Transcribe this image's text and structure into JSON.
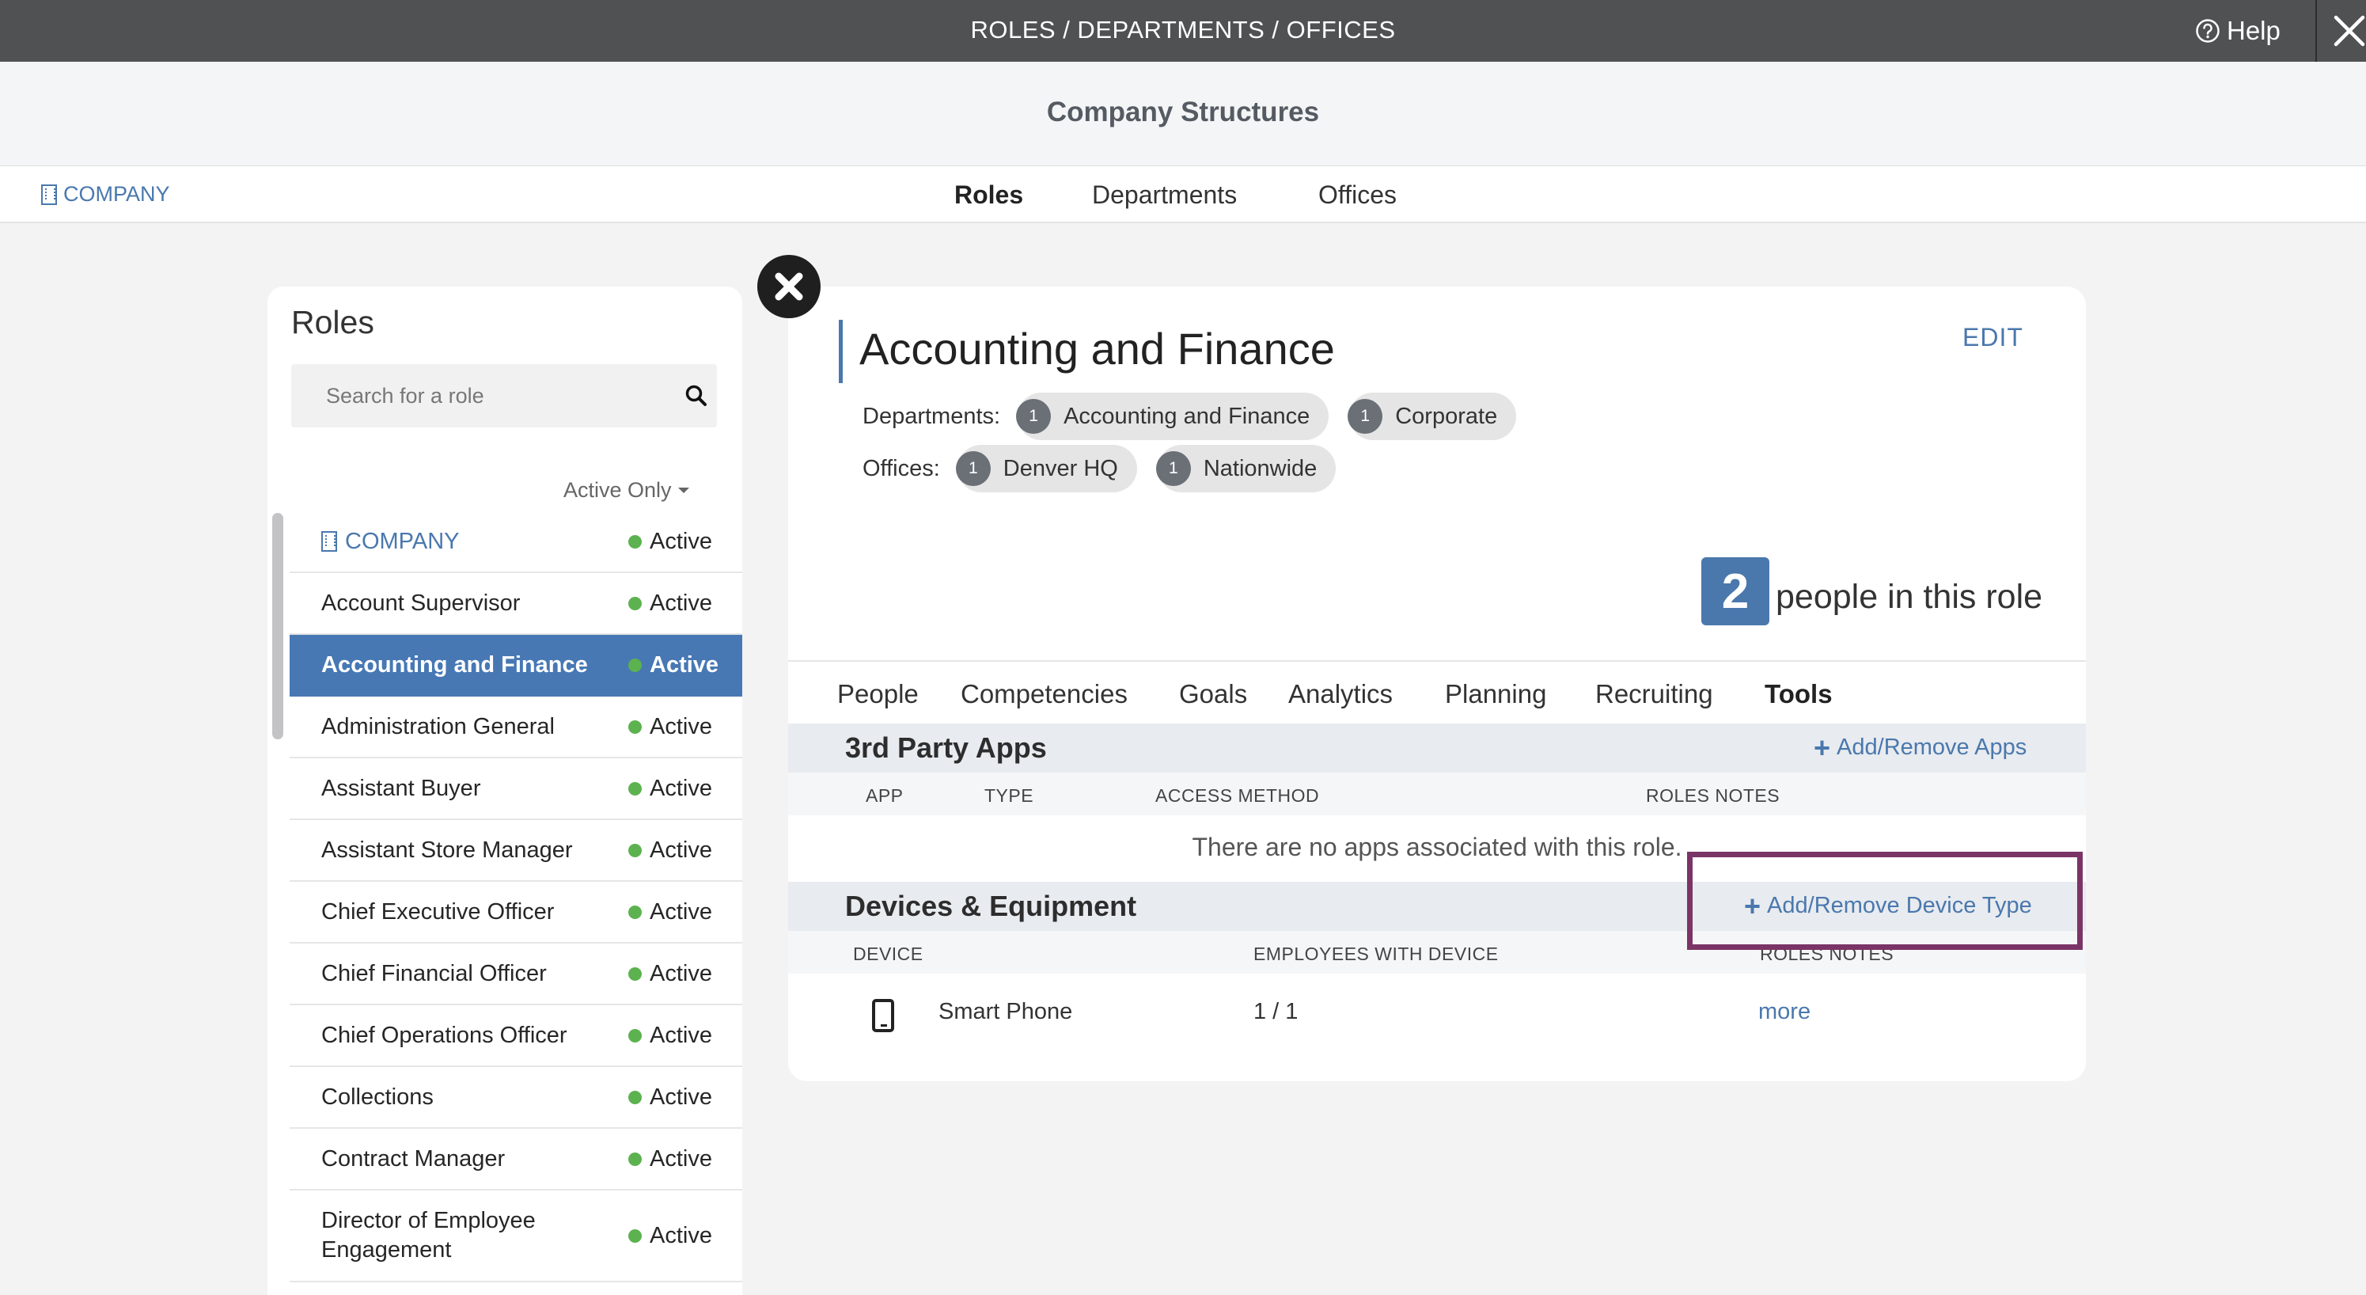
{
  "topbar": {
    "title": "ROLES / DEPARTMENTS / OFFICES",
    "help_label": "Help"
  },
  "header": {
    "title": "Company Structures"
  },
  "tabbar": {
    "company_label": "COMPANY",
    "tabs": [
      {
        "label": "Roles",
        "active": true
      },
      {
        "label": "Departments",
        "active": false
      },
      {
        "label": "Offices",
        "active": false
      }
    ]
  },
  "roles_panel": {
    "heading": "Roles",
    "search_placeholder": "Search for a role",
    "filter_label": "Active Only",
    "items": [
      {
        "name": "COMPANY",
        "status": "Active",
        "type": "company"
      },
      {
        "name": "Account Supervisor",
        "status": "Active"
      },
      {
        "name": "Accounting and Finance",
        "status": "Active",
        "selected": true
      },
      {
        "name": "Administration General",
        "status": "Active"
      },
      {
        "name": "Assistant Buyer",
        "status": "Active"
      },
      {
        "name": "Assistant Store Manager",
        "status": "Active"
      },
      {
        "name": "Chief Executive Officer",
        "status": "Active"
      },
      {
        "name": "Chief Financial Officer",
        "status": "Active"
      },
      {
        "name": "Chief Operations Officer",
        "status": "Active"
      },
      {
        "name": "Collections",
        "status": "Active"
      },
      {
        "name": "Contract Manager",
        "status": "Active"
      },
      {
        "name": "Director of Employee Engagement",
        "status": "Active",
        "tall": true
      }
    ]
  },
  "detail": {
    "title": "Accounting and Finance",
    "edit_label": "EDIT",
    "departments_label": "Departments:",
    "departments": [
      {
        "count": "1",
        "name": "Accounting and Finance"
      },
      {
        "count": "1",
        "name": "Corporate"
      }
    ],
    "offices_label": "Offices:",
    "offices": [
      {
        "count": "1",
        "name": "Denver HQ"
      },
      {
        "count": "1",
        "name": "Nationwide"
      }
    ],
    "people_count": "2",
    "people_text": "people in this role",
    "tabs": [
      "People",
      "Competencies",
      "Goals",
      "Analytics",
      "Planning",
      "Recruiting",
      "Tools"
    ],
    "active_tab": "Tools",
    "apps": {
      "title": "3rd Party Apps",
      "action": "Add/Remove Apps",
      "columns": [
        "APP",
        "TYPE",
        "ACCESS METHOD",
        "ROLES NOTES"
      ],
      "empty_message": "There are no apps associated with this role."
    },
    "devices": {
      "title": "Devices & Equipment",
      "action": "Add/Remove Device Type",
      "columns": [
        "DEVICE",
        "EMPLOYEES WITH DEVICE",
        "ROLES NOTES"
      ],
      "rows": [
        {
          "icon": "smartphone-icon",
          "name": "Smart Phone",
          "employees": "1 / 1",
          "notes_link": "more"
        }
      ]
    }
  },
  "colors": {
    "accent": "#4a78ad",
    "selected_row": "#4778b4",
    "active_dot": "#5cb24f",
    "highlight": "#7b3466",
    "topbar": "#505153"
  }
}
